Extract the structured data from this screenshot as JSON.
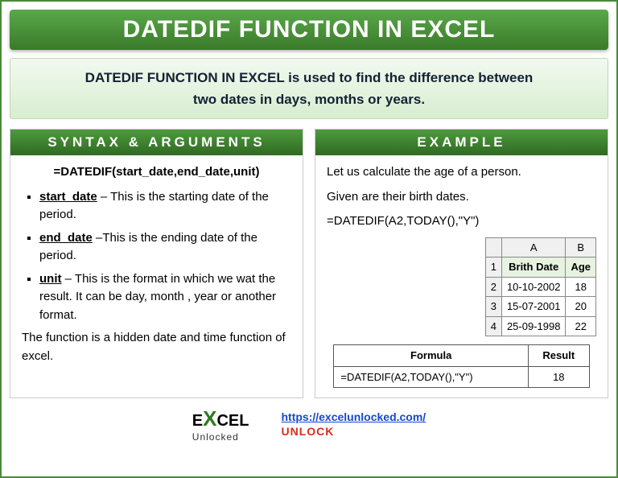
{
  "title": "DATEDIF FUNCTION IN EXCEL",
  "intro": {
    "strong": "DATEDIF FUNCTION IN EXCEL",
    "rest1": " is used to find the difference between",
    "rest2": "two dates in days, months or years."
  },
  "syntax": {
    "header": "SYNTAX & ARGUMENTS",
    "formula": "=DATEDIF(start_date,end_date,unit)",
    "args": [
      {
        "name": "start_date",
        "desc": " – This is the starting date of the period."
      },
      {
        "name": "end_date",
        "desc": " –This is the ending date of the period."
      },
      {
        "name": "unit",
        "desc": " – This is the format in which we wat the result. It can be day, month , year or another format."
      }
    ],
    "note": "The function is a hidden date and time function of excel."
  },
  "example": {
    "header": "EXAMPLE",
    "intro1": "Let us calculate the age of a person.",
    "intro2": "Given are their birth dates.",
    "formula": "=DATEDIF(A2,TODAY(),\"Y\")",
    "sheet": {
      "colA": "A",
      "colB": "B",
      "h1": "Brith Date",
      "h2": "Age",
      "rows": [
        {
          "n": "2",
          "a": "10-10-2002",
          "b": "18"
        },
        {
          "n": "3",
          "a": "15-07-2001",
          "b": "20"
        },
        {
          "n": "4",
          "a": "25-09-1998",
          "b": "22"
        }
      ]
    },
    "result": {
      "h1": "Formula",
      "h2": "Result",
      "f": "=DATEDIF(A2,TODAY(),\"Y\")",
      "r": "18"
    }
  },
  "footer": {
    "logo_pre": "E",
    "logo_x": "X",
    "logo_post": "CEL",
    "logo_sub": "Unlocked",
    "url": "https://excelunlocked.com/",
    "unlock": "UNLOCK"
  }
}
